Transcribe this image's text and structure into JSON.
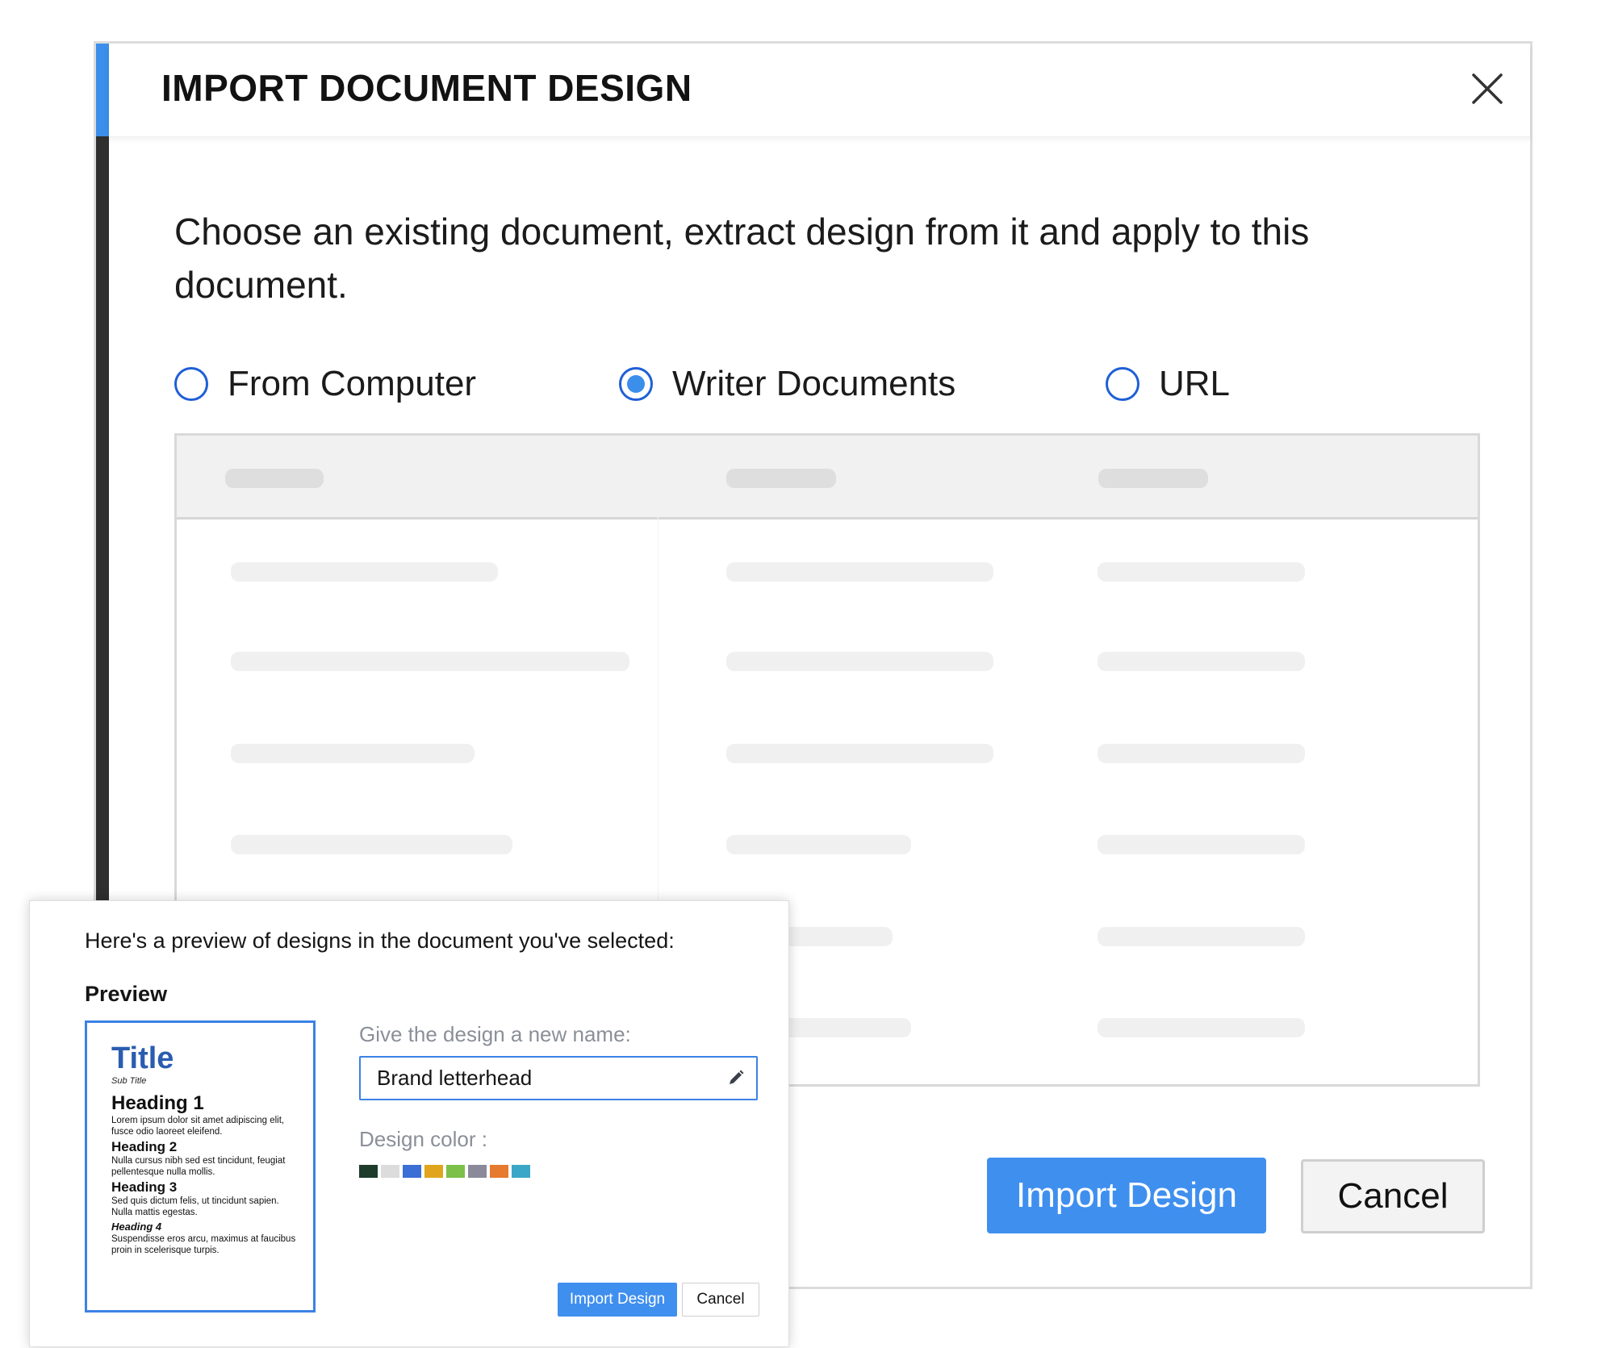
{
  "dialog": {
    "title": "IMPORT DOCUMENT DESIGN",
    "close_icon": "close-icon",
    "instruction": "Choose an existing document, extract design from it and apply to this document.",
    "source_options": [
      {
        "label": "From Computer",
        "selected": false
      },
      {
        "label": "Writer Documents",
        "selected": true
      },
      {
        "label": "URL",
        "selected": false
      }
    ],
    "table_state": "loading-placeholder",
    "import_button": "Import Design",
    "cancel_button": "Cancel",
    "accent_color": "#3b8eea"
  },
  "preview_panel": {
    "intro": "Here's a preview of designs in the document you've selected:",
    "preview_label": "Preview",
    "thumbnail": {
      "title": "Title",
      "subtitle": "Sub Title",
      "heading1": "Heading 1",
      "para1": "Lorem ipsum dolor sit amet adipiscing elit, fusce odio laoreet eleifend.",
      "heading2": "Heading 2",
      "para2": "Nulla cursus nibh sed est tincidunt, feugiat pellentesque nulla mollis.",
      "heading3": "Heading 3",
      "para3": "Sed quis dictum felis, ut tincidunt sapien. Nulla mattis egestas.",
      "heading4": "Heading 4",
      "para4": "Suspendisse eros arcu, maximus at faucibus proin in scelerisque turpis."
    },
    "name_label": "Give the design a new name:",
    "name_value": "Brand letterhead",
    "edit_icon": "pencil-icon",
    "color_label": "Design color :",
    "design_colors": [
      "#1e3b2c",
      "#dcdcdc",
      "#3b6fd6",
      "#e0a51c",
      "#7cc04a",
      "#8a8a9a",
      "#e67a2e",
      "#3aa7c7"
    ],
    "import_button": "Import Design",
    "cancel_button": "Cancel"
  }
}
